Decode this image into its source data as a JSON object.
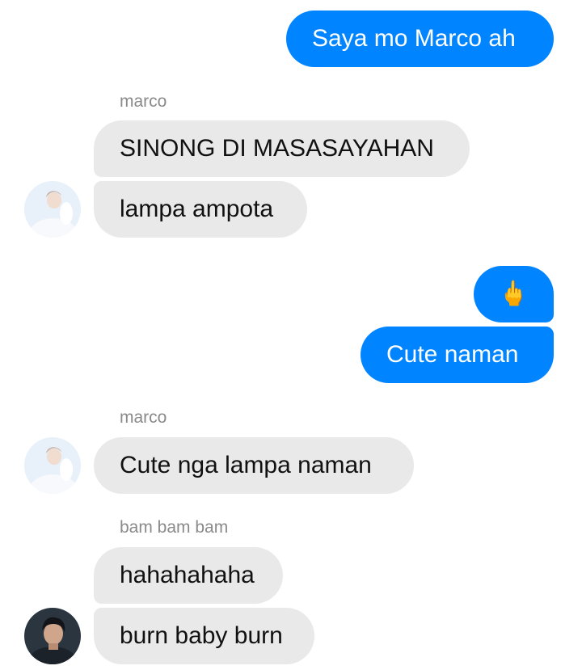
{
  "messages": {
    "m1": {
      "text": "Saya mo Marco ah"
    },
    "g1": {
      "sender": "marco",
      "b1": "SINONG DI MASASAYAHAN",
      "b2": "lampa ampota"
    },
    "m2": {
      "emoji": "🖕"
    },
    "m3": {
      "text": "Cute naman"
    },
    "g2": {
      "sender": "marco",
      "b1": "Cute nga lampa naman"
    },
    "g3": {
      "sender": "bam bam bam",
      "b1": "hahahahaha",
      "b2": "burn baby burn"
    }
  },
  "colors": {
    "outgoing_bubble": "#0084ff",
    "incoming_bubble": "#e9e9e9",
    "sender_name": "#8a8a8a"
  }
}
